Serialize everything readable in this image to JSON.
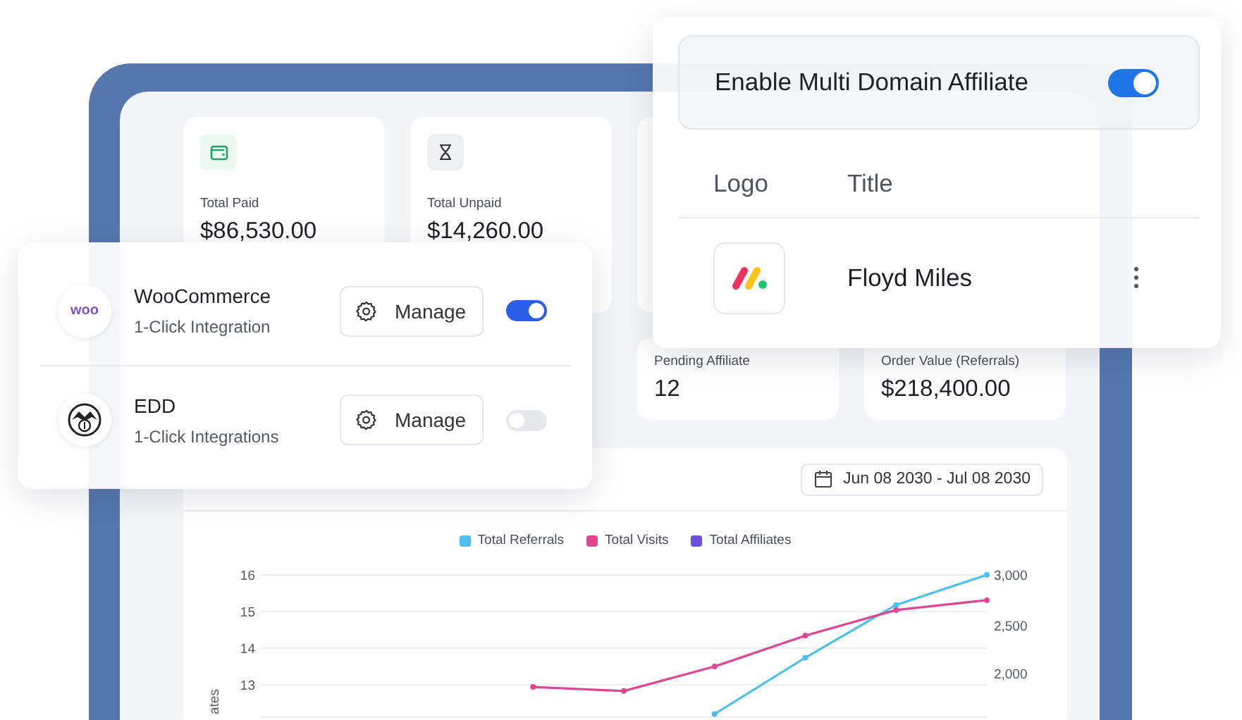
{
  "stats_top": [
    {
      "label": "Total Paid",
      "value": "$86,530.00"
    },
    {
      "label": "Total Unpaid",
      "value": "$14,260.00"
    }
  ],
  "stats_second": [
    {
      "label": "Pending Affiliate",
      "value": "12"
    },
    {
      "label": "Order Value (Referrals)",
      "value": "$218,400.00"
    }
  ],
  "chart": {
    "date_range": "Jun 08 2030 - Jul 08 2030",
    "right_axis_labels": [
      "3,000",
      "2,500",
      "2,000"
    ],
    "chart_data": {
      "type": "line",
      "ylabel": "ates",
      "ylim": [
        12.12,
        16
      ],
      "yticks": [
        13,
        14,
        15,
        16
      ],
      "grid": true,
      "series": [
        {
          "name": "Total Referrals",
          "color": "#4cbfec",
          "marker": "circle",
          "values": [
            null,
            null,
            null,
            null,
            null,
            12.2,
            13.74,
            15.18,
            16.0
          ]
        },
        {
          "name": "Total Visits",
          "color": "#e0468f",
          "marker": "circle",
          "values": [
            null,
            null,
            null,
            12.94,
            12.83,
            13.5,
            14.34,
            15.04,
            15.31
          ]
        },
        {
          "name": "Total Affiliates",
          "color": "#6d4fe0",
          "values": [
            null,
            null,
            null,
            null,
            null,
            null,
            null,
            null,
            null
          ]
        }
      ]
    }
  },
  "integrations": [
    {
      "logo_text": "woo",
      "name": "WooCommerce",
      "subtitle": "1-Click Integration",
      "button": "Manage",
      "on": true
    },
    {
      "name": "EDD",
      "subtitle": "1-Click Integrations",
      "button": "Manage",
      "on": false
    }
  ],
  "domain": {
    "label": "Enable Multi Domain Affiliate",
    "on": true,
    "columns": [
      "Logo",
      "Title"
    ],
    "rows": [
      {
        "title": "Floyd Miles"
      }
    ]
  }
}
